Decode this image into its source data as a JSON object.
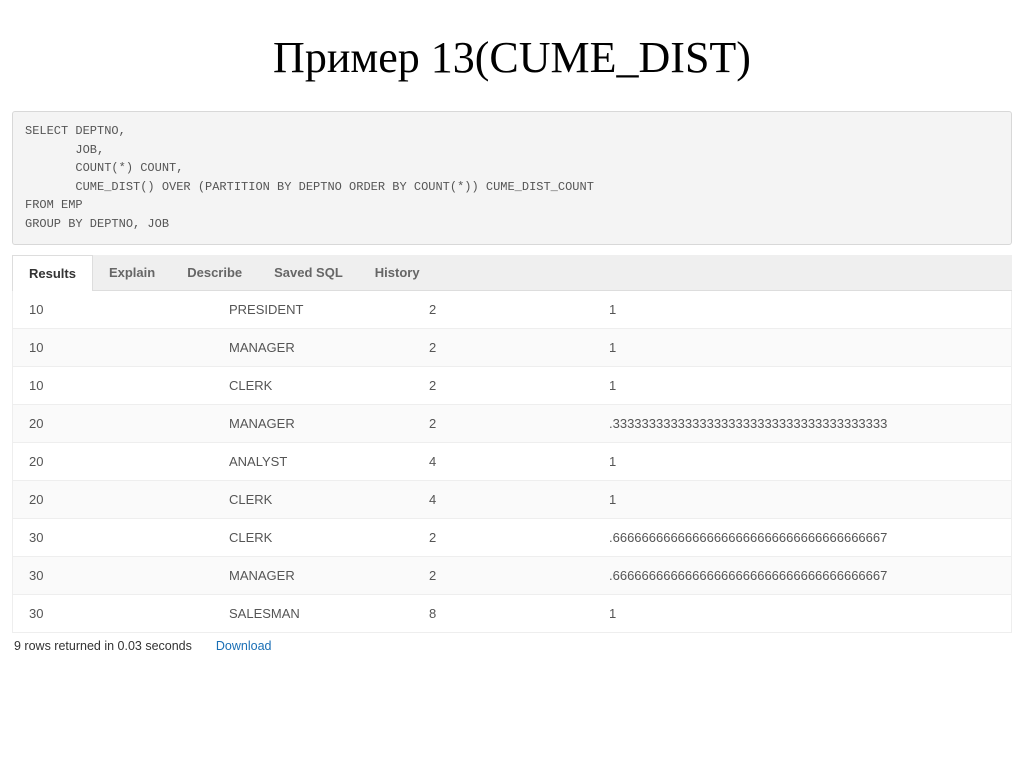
{
  "title": "Пример 13(CUME_DIST)",
  "sql": "SELECT DEPTNO,\n       JOB,\n       COUNT(*) COUNT,\n       CUME_DIST() OVER (PARTITION BY DEPTNO ORDER BY COUNT(*)) CUME_DIST_COUNT\nFROM EMP\nGROUP BY DEPTNO, JOB",
  "tabs": {
    "results": "Results",
    "explain": "Explain",
    "describe": "Describe",
    "saved_sql": "Saved SQL",
    "history": "History"
  },
  "rows": [
    {
      "deptno": "10",
      "job": "PRESIDENT",
      "count": "2",
      "cume": "1"
    },
    {
      "deptno": "10",
      "job": "MANAGER",
      "count": "2",
      "cume": "1"
    },
    {
      "deptno": "10",
      "job": "CLERK",
      "count": "2",
      "cume": "1"
    },
    {
      "deptno": "20",
      "job": "MANAGER",
      "count": "2",
      "cume": ".33333333333333333333333333333333333333"
    },
    {
      "deptno": "20",
      "job": "ANALYST",
      "count": "4",
      "cume": "1"
    },
    {
      "deptno": "20",
      "job": "CLERK",
      "count": "4",
      "cume": "1"
    },
    {
      "deptno": "30",
      "job": "CLERK",
      "count": "2",
      "cume": ".66666666666666666666666666666666666667"
    },
    {
      "deptno": "30",
      "job": "MANAGER",
      "count": "2",
      "cume": ".66666666666666666666666666666666666667"
    },
    {
      "deptno": "30",
      "job": "SALESMAN",
      "count": "8",
      "cume": "1"
    }
  ],
  "status": {
    "summary": "9 rows returned in 0.03 seconds",
    "download": "Download"
  }
}
